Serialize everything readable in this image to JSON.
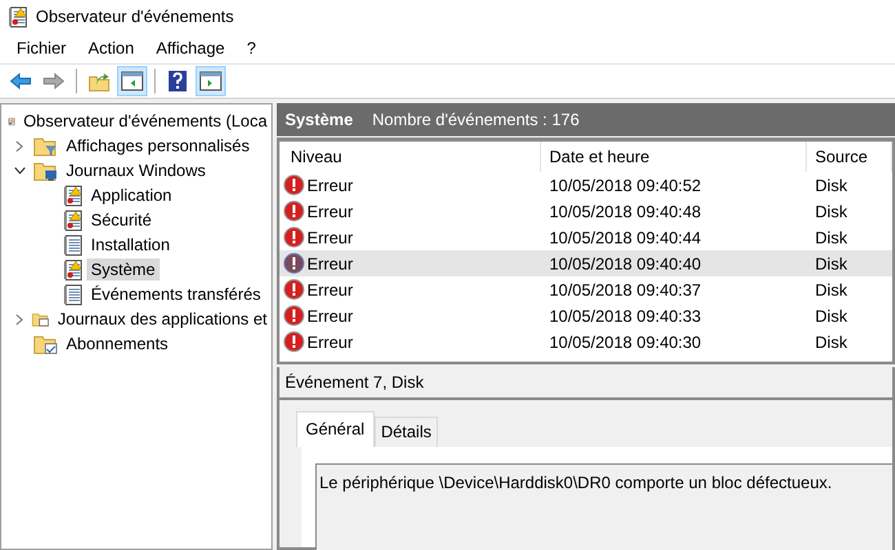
{
  "window": {
    "title": "Observateur d'événements"
  },
  "menu": [
    "Fichier",
    "Action",
    "Affichage",
    "?"
  ],
  "toolbar": [
    {
      "kind": "back",
      "disabled": false,
      "pressed": false
    },
    {
      "kind": "forward",
      "disabled": true,
      "pressed": false
    },
    {
      "kind": "separator"
    },
    {
      "kind": "folder-up",
      "disabled": false,
      "pressed": false
    },
    {
      "kind": "pane-left",
      "disabled": false,
      "pressed": true
    },
    {
      "kind": "separator"
    },
    {
      "kind": "help",
      "disabled": false,
      "pressed": false
    },
    {
      "kind": "pane-right",
      "disabled": false,
      "pressed": true
    }
  ],
  "tree": [
    {
      "label": "Observateur d'événements (Loca",
      "kind": "root",
      "selected": false,
      "children": [
        {
          "label": "Affichages personnalisés",
          "kind": "filter",
          "expanded": false,
          "selected": false
        },
        {
          "label": "Journaux Windows",
          "kind": "computer",
          "expanded": true,
          "selected": false,
          "children": [
            {
              "label": "Application",
              "kind": "alertlog",
              "selected": false
            },
            {
              "label": "Sécurité",
              "kind": "alertlog",
              "selected": false
            },
            {
              "label": "Installation",
              "kind": "log",
              "selected": false
            },
            {
              "label": "Système",
              "kind": "alertlog",
              "selected": true
            },
            {
              "label": "Événements transférés",
              "kind": "log",
              "selected": false
            }
          ]
        },
        {
          "label": "Journaux des applications et",
          "kind": "window",
          "expanded": false,
          "selected": false
        },
        {
          "label": "Abonnements",
          "kind": "subscription",
          "selected": false
        }
      ]
    }
  ],
  "log_header": {
    "title": "Système",
    "count": "Nombre d'événements : 176"
  },
  "table": {
    "columns": [
      "Niveau",
      "Date et heure",
      "Source"
    ],
    "rows": [
      {
        "level": "Erreur",
        "date": "10/05/2018 09:40:52",
        "source": "Disk",
        "selected": false
      },
      {
        "level": "Erreur",
        "date": "10/05/2018 09:40:48",
        "source": "Disk",
        "selected": false
      },
      {
        "level": "Erreur",
        "date": "10/05/2018 09:40:44",
        "source": "Disk",
        "selected": false
      },
      {
        "level": "Erreur",
        "date": "10/05/2018 09:40:40",
        "source": "Disk",
        "selected": true
      },
      {
        "level": "Erreur",
        "date": "10/05/2018 09:40:37",
        "source": "Disk",
        "selected": false
      },
      {
        "level": "Erreur",
        "date": "10/05/2018 09:40:33",
        "source": "Disk",
        "selected": false
      },
      {
        "level": "Erreur",
        "date": "10/05/2018 09:40:30",
        "source": "Disk",
        "selected": false
      }
    ]
  },
  "detail": {
    "title": "Événement 7, Disk",
    "tabs": [
      {
        "label": "Général",
        "selected": true
      },
      {
        "label": "Détails",
        "selected": false
      }
    ],
    "message": "Le périphérique \\Device\\Harddisk0\\DR0 comporte un bloc défectueux."
  }
}
